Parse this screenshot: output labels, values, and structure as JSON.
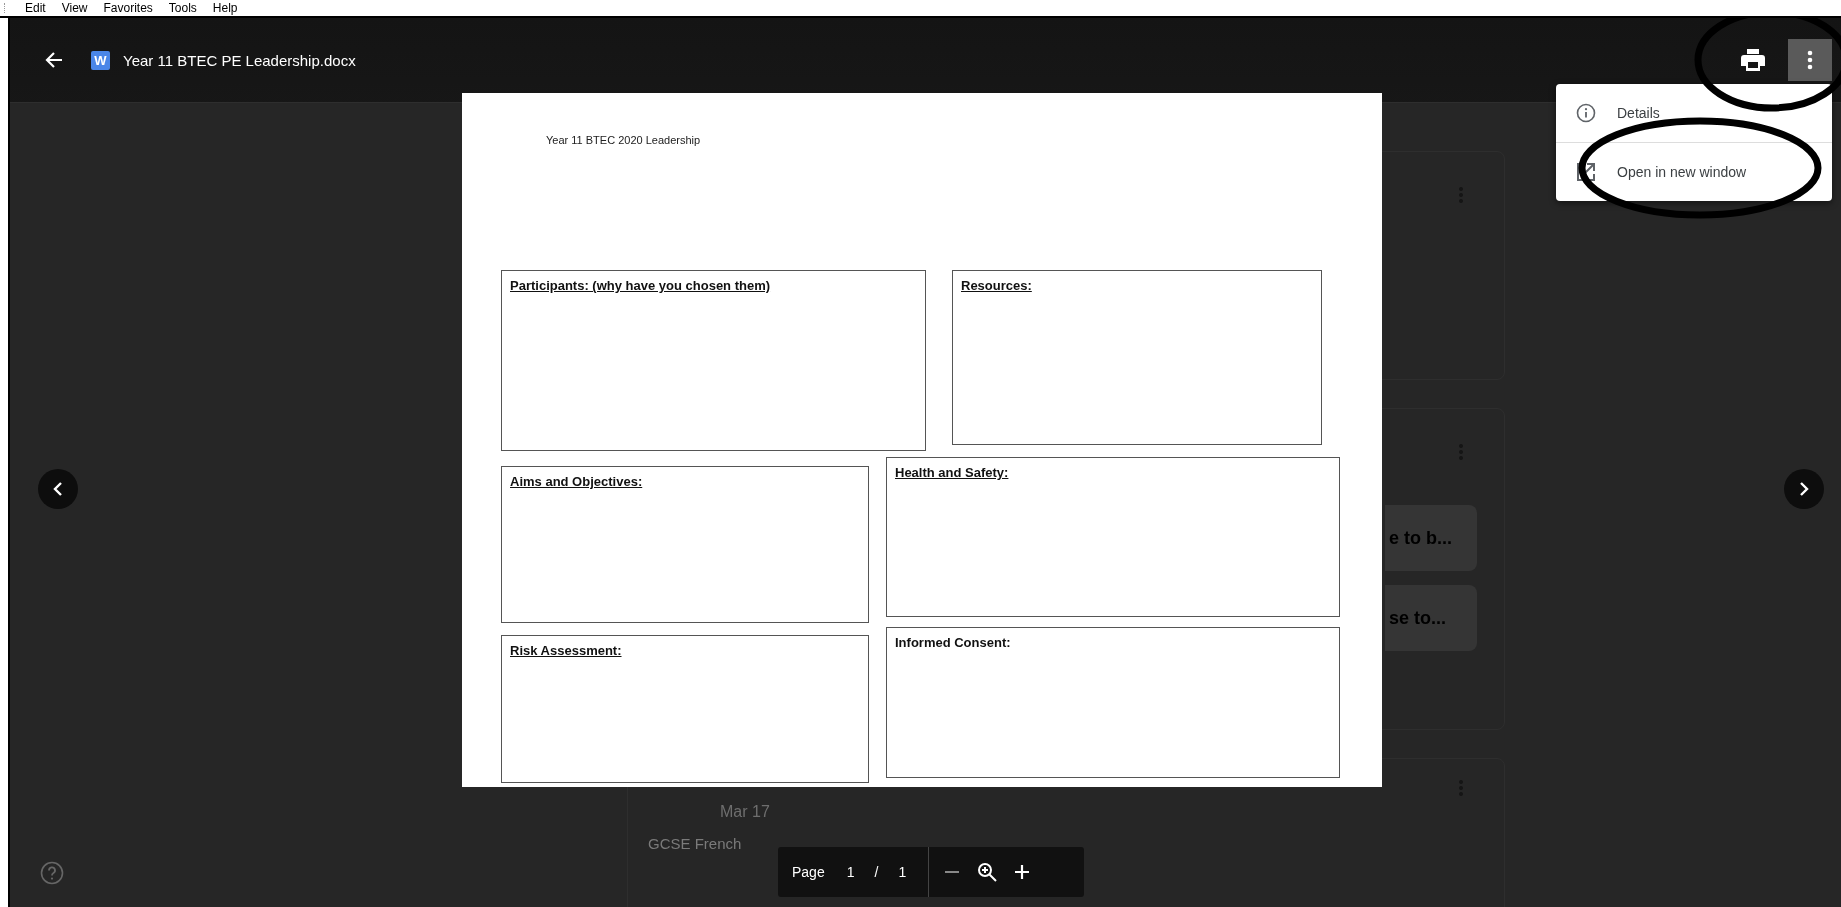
{
  "menu_bar": {
    "items": [
      "Edit",
      "View",
      "Favorites",
      "Tools",
      "Help"
    ]
  },
  "background_page": {
    "attachments": [
      "e to b...",
      "se to..."
    ],
    "post": {
      "date": "Mar 17",
      "class_name": "GCSE French"
    }
  },
  "viewer_header": {
    "file_badge": "W",
    "title": "Year 11 BTEC PE Leadership.docx"
  },
  "overflow_menu": {
    "items": [
      {
        "kind": "details",
        "label": "Details"
      },
      {
        "kind": "open_window",
        "label": "Open in new window"
      }
    ]
  },
  "document": {
    "heading": "Year 11 BTEC 2020 Leadership",
    "rows": [
      [
        {
          "label": "Participants: (why have you chosen them)",
          "underlined": true
        },
        {
          "label": "Resources: ",
          "underlined": true
        }
      ],
      [
        {
          "label": "Aims and Objectives: ",
          "underlined": true
        },
        {
          "label": "Health and Safety: ",
          "underlined": true
        }
      ],
      [
        {
          "label": "Risk Assessment: ",
          "underlined": true
        },
        {
          "label": "Informed Consent:",
          "underlined": false
        }
      ]
    ]
  },
  "page_toolbar": {
    "page_label": "Page",
    "current_page": "1",
    "separator": "/",
    "total_pages": "1"
  }
}
